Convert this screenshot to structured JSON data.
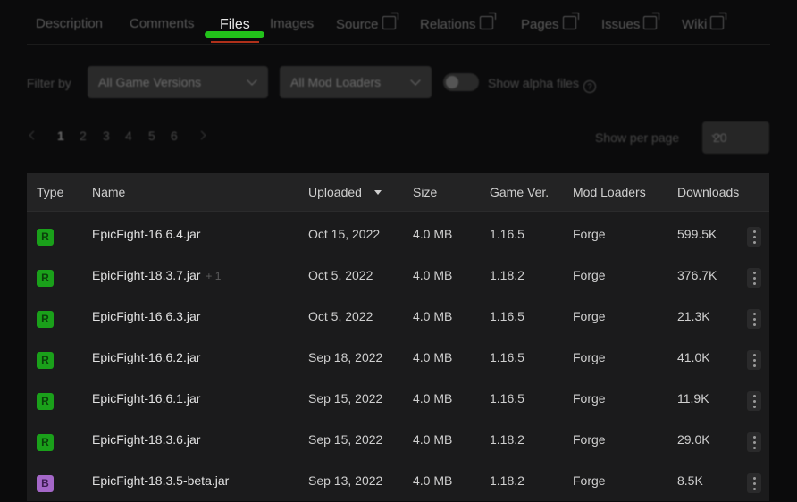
{
  "tabs": [
    {
      "label": "Description",
      "external": false
    },
    {
      "label": "Comments",
      "external": false
    },
    {
      "label": "Files",
      "external": false,
      "active": true
    },
    {
      "label": "Images",
      "external": false
    },
    {
      "label": "Source",
      "external": true
    },
    {
      "label": "Relations",
      "external": true
    },
    {
      "label": "Pages",
      "external": true
    },
    {
      "label": "Issues",
      "external": true
    },
    {
      "label": "Wiki",
      "external": true
    }
  ],
  "filters": {
    "label": "Filter by",
    "game_versions": "All Game Versions",
    "mod_loaders": "All Mod Loaders",
    "alpha_toggle_label": "Show alpha files",
    "alpha_toggle_on": false
  },
  "pagination": {
    "pages": [
      "1",
      "2",
      "3",
      "4",
      "5",
      "6"
    ],
    "current": "1",
    "per_page_label": "Show per page",
    "per_page_value": "20"
  },
  "table": {
    "columns": {
      "type": "Type",
      "name": "Name",
      "uploaded": "Uploaded",
      "size": "Size",
      "game_ver": "Game Ver.",
      "mod_loaders": "Mod Loaders",
      "downloads": "Downloads"
    },
    "rows": [
      {
        "type": "R",
        "name": "EpicFight-16.6.4.jar",
        "extra": "",
        "uploaded": "Oct 15, 2022",
        "size": "4.0 MB",
        "game_ver": "1.16.5",
        "loader": "Forge",
        "downloads": "599.5K"
      },
      {
        "type": "R",
        "name": "EpicFight-18.3.7.jar",
        "extra": "+ 1",
        "uploaded": "Oct 5, 2022",
        "size": "4.0 MB",
        "game_ver": "1.18.2",
        "loader": "Forge",
        "downloads": "376.7K"
      },
      {
        "type": "R",
        "name": "EpicFight-16.6.3.jar",
        "extra": "",
        "uploaded": "Oct 5, 2022",
        "size": "4.0 MB",
        "game_ver": "1.16.5",
        "loader": "Forge",
        "downloads": "21.3K"
      },
      {
        "type": "R",
        "name": "EpicFight-16.6.2.jar",
        "extra": "",
        "uploaded": "Sep 18, 2022",
        "size": "4.0 MB",
        "game_ver": "1.16.5",
        "loader": "Forge",
        "downloads": "41.0K"
      },
      {
        "type": "R",
        "name": "EpicFight-16.6.1.jar",
        "extra": "",
        "uploaded": "Sep 15, 2022",
        "size": "4.0 MB",
        "game_ver": "1.16.5",
        "loader": "Forge",
        "downloads": "11.9K"
      },
      {
        "type": "R",
        "name": "EpicFight-18.3.6.jar",
        "extra": "",
        "uploaded": "Sep 15, 2022",
        "size": "4.0 MB",
        "game_ver": "1.18.2",
        "loader": "Forge",
        "downloads": "29.0K"
      },
      {
        "type": "B",
        "name": "EpicFight-18.3.5-beta.jar",
        "extra": "",
        "uploaded": "Sep 13, 2022",
        "size": "4.0 MB",
        "game_ver": "1.18.2",
        "loader": "Forge",
        "downloads": "8.5K"
      }
    ]
  },
  "colors": {
    "accent_green": "#22c21a",
    "release_badge": "#1aa01a",
    "beta_badge": "#a467c8"
  }
}
